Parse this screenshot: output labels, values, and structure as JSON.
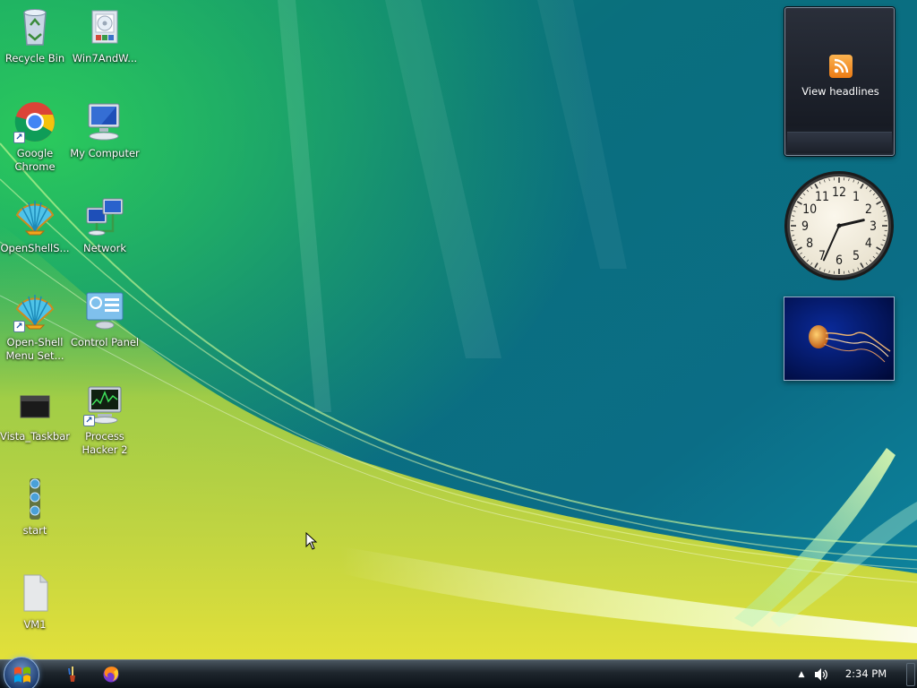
{
  "desktop": {
    "icons": [
      {
        "label": "Recycle Bin",
        "icon": "recycle-bin-icon",
        "shortcut": false
      },
      {
        "label": "Win7AndW...",
        "icon": "installer-icon",
        "shortcut": false
      },
      {
        "label": "Google\nChrome",
        "icon": "chrome-icon",
        "shortcut": true
      },
      {
        "label": "My Computer",
        "icon": "computer-icon",
        "shortcut": false
      },
      {
        "label": "OpenShellS...",
        "icon": "shell-icon",
        "shortcut": false
      },
      {
        "label": "Network",
        "icon": "network-icon",
        "shortcut": false
      },
      {
        "label": "Open-Shell\nMenu Set...",
        "icon": "shell-icon",
        "shortcut": true
      },
      {
        "label": "Control Panel",
        "icon": "control-panel-icon",
        "shortcut": false
      },
      {
        "label": "Vista_Taskbar",
        "icon": "file-icon",
        "shortcut": false
      },
      {
        "label": "Process\nHacker 2",
        "icon": "process-hacker-icon",
        "shortcut": true
      },
      {
        "label": "start",
        "icon": "orbs-icon",
        "shortcut": false
      },
      {
        "label": "VM1",
        "icon": "document-icon",
        "shortcut": false
      }
    ]
  },
  "gadgets": {
    "feed": {
      "label": "View headlines"
    },
    "clock": {
      "hour": 2,
      "minute": 34,
      "numerals": [
        "12",
        "1",
        "2",
        "3",
        "4",
        "5",
        "6",
        "7",
        "8",
        "9",
        "10",
        "11"
      ]
    },
    "slideshow": {
      "subject": "jellyfish"
    }
  },
  "taskbar": {
    "quick_launch": [
      {
        "icon": "paintbrush-icon"
      },
      {
        "icon": "firefox-icon"
      }
    ],
    "tray": {
      "time": "2:34 PM"
    }
  },
  "colors": {
    "wallpaper_dark": "#0a6f7d",
    "wallpaper_green": "#5fc34a",
    "wallpaper_yellow": "#d6dc3c",
    "taskbar": "#1e262d",
    "rss_orange": "#f08a1c"
  }
}
